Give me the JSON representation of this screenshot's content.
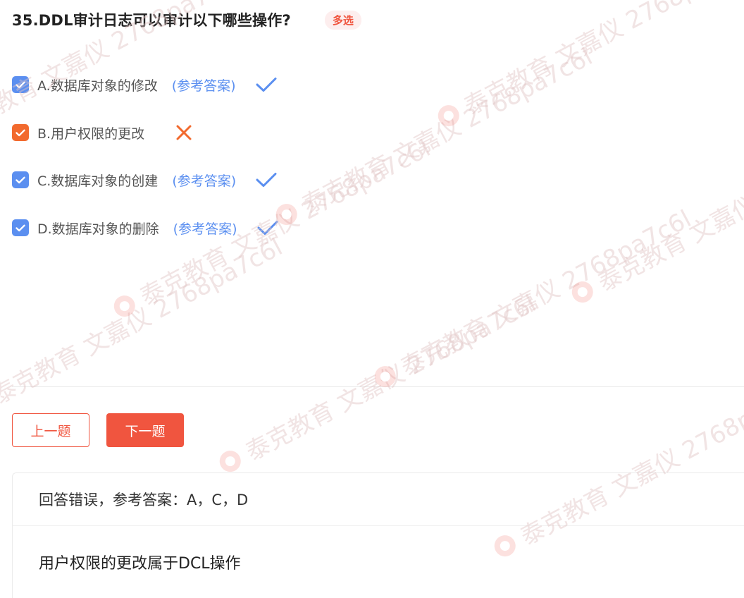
{
  "question": {
    "title": "35.DDL审计日志可以审计以下哪些操作?",
    "badge": "多选"
  },
  "options": [
    {
      "text": "A.数据库对象的修改",
      "ref": "(参考答案)",
      "checked": true,
      "checkbox_color": "#5b8ff0",
      "mark": "check-icon",
      "mark_color": "#5b8ff0"
    },
    {
      "text": "B.用户权限的更改",
      "ref": "",
      "checked": true,
      "checkbox_color": "#f26a2e",
      "mark": "cross-icon",
      "mark_color": "#f26a2e"
    },
    {
      "text": "C.数据库对象的创建",
      "ref": "(参考答案)",
      "checked": true,
      "checkbox_color": "#5b8ff0",
      "mark": "check-icon",
      "mark_color": "#5b8ff0"
    },
    {
      "text": "D.数据库对象的删除",
      "ref": "(参考答案)",
      "checked": true,
      "checkbox_color": "#5b8ff0",
      "mark": "check-icon",
      "mark_color": "#5b8ff0"
    }
  ],
  "nav": {
    "prev_label": "上一题",
    "next_label": "下一题"
  },
  "result": {
    "status_line": "回答错误，参考答案：A，C，D",
    "explanation": "用户权限的更改属于DCL操作"
  },
  "watermark": {
    "text": "泰克教育 文嘉仪 2768pa7c6l"
  },
  "colors": {
    "accent_red": "#f0553f",
    "checkbox_blue": "#5b8ff0",
    "checkbox_orange": "#f26a2e"
  }
}
